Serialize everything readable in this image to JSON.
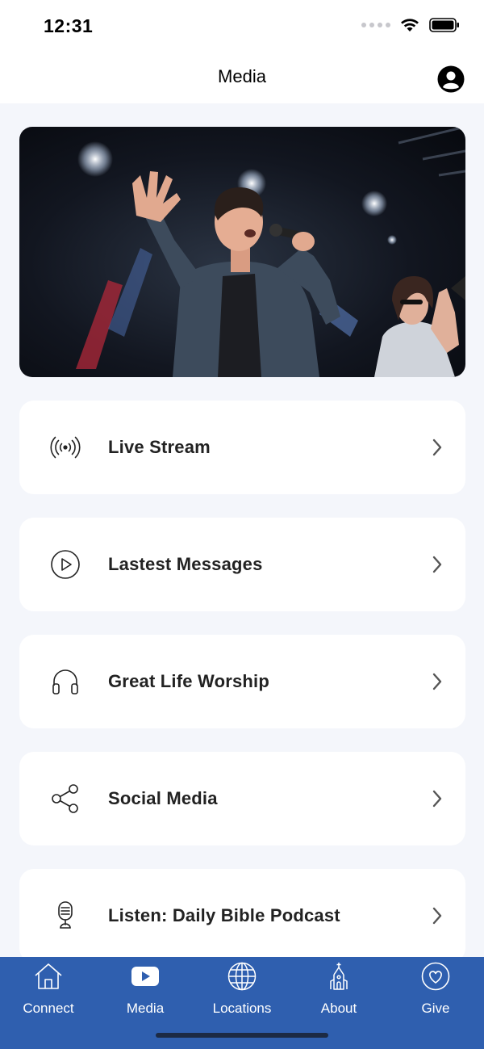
{
  "status_bar": {
    "time": "12:31"
  },
  "header": {
    "title": "Media",
    "profile_icon": "user-circle-icon"
  },
  "hero": {
    "description_icon": "worship-photo"
  },
  "menu": [
    {
      "label": "Live Stream",
      "icon": "broadcast-icon"
    },
    {
      "label": "Lastest Messages",
      "icon": "play-circle-icon"
    },
    {
      "label": "Great Life Worship",
      "icon": "headphones-icon"
    },
    {
      "label": "Social Media",
      "icon": "share-icon"
    },
    {
      "label": "Listen: Daily Bible Podcast",
      "icon": "microphone-icon"
    }
  ],
  "tabs": [
    {
      "label": "Connect",
      "icon": "home-icon"
    },
    {
      "label": "Media",
      "icon": "video-play-icon",
      "active": true
    },
    {
      "label": "Locations",
      "icon": "globe-icon"
    },
    {
      "label": "About",
      "icon": "church-icon"
    },
    {
      "label": "Give",
      "icon": "heart-circle-icon"
    }
  ],
  "colors": {
    "tab_bar": "#2f5faf",
    "background": "#f4f6fb",
    "card": "#ffffff",
    "text": "#222222"
  }
}
